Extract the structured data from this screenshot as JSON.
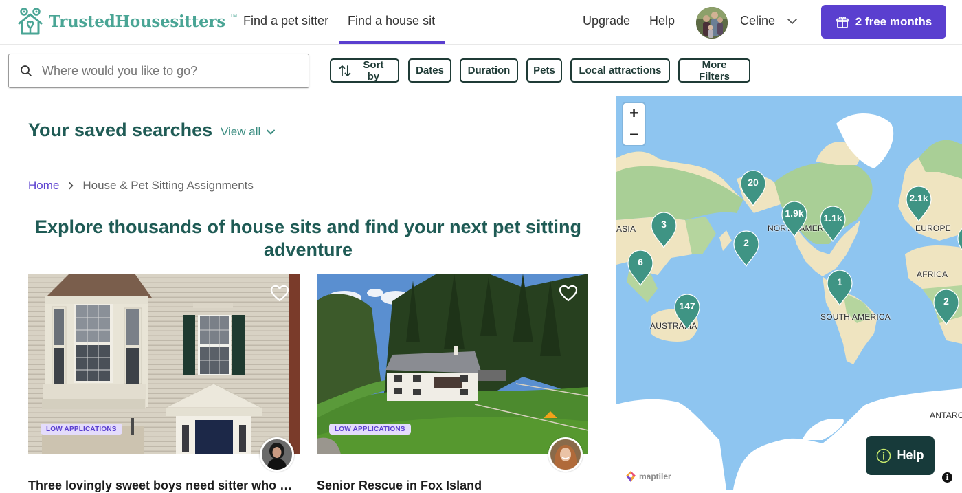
{
  "header": {
    "logo_text": "TrustedHousesitters",
    "logo_tm": "TM",
    "nav": [
      {
        "label": "Find a pet sitter",
        "active": false
      },
      {
        "label": "Find a house sit",
        "active": true
      }
    ],
    "upgrade_label": "Upgrade",
    "help_label": "Help",
    "user_name": "Celine",
    "promo_label": "2 free months",
    "accent_color": "#5a3fcf",
    "brand_color": "#4aa595"
  },
  "filters": {
    "search_placeholder": "Where would you like to go?",
    "search_value": "",
    "chips": [
      {
        "label": "Sort by",
        "icon": "sort-icon"
      },
      {
        "label": "Dates"
      },
      {
        "label": "Duration"
      },
      {
        "label": "Pets"
      },
      {
        "label": "Local attractions"
      },
      {
        "label": "More Filters"
      }
    ]
  },
  "saved_searches": {
    "title": "Your saved searches",
    "view_all_label": "View all"
  },
  "breadcrumb": {
    "home": "Home",
    "current": "House & Pet Sitting Assignments"
  },
  "hero": {
    "title": "Explore thousands of house sits and find your next pet sitting adventure"
  },
  "listings": [
    {
      "title": "Three lovingly sweet boys need sitter who will…",
      "badge": "LOW APPLICATIONS",
      "favorited": false
    },
    {
      "title": "Senior Rescue in Fox Island",
      "badge": "LOW APPLICATIONS",
      "favorited": false
    }
  ],
  "map": {
    "zoom_in": "+",
    "zoom_out": "−",
    "markers": [
      {
        "label": "20"
      },
      {
        "label": "3"
      },
      {
        "label": "1.9k"
      },
      {
        "label": "1.1k"
      },
      {
        "label": "2.1k"
      },
      {
        "label": "2"
      },
      {
        "label": "6"
      },
      {
        "label": "1"
      },
      {
        "label": "147"
      },
      {
        "label": "2"
      }
    ],
    "continents": [
      "ASIA",
      "NORTH AMERICA",
      "EUROPE",
      "AFRICA",
      "SOUTH AMERICA",
      "AUSTRALIA",
      "ANTARCTICA"
    ],
    "attribution": "maptiler",
    "help_label": "Help",
    "info_label": "i",
    "marker_color": "#3f9484"
  }
}
